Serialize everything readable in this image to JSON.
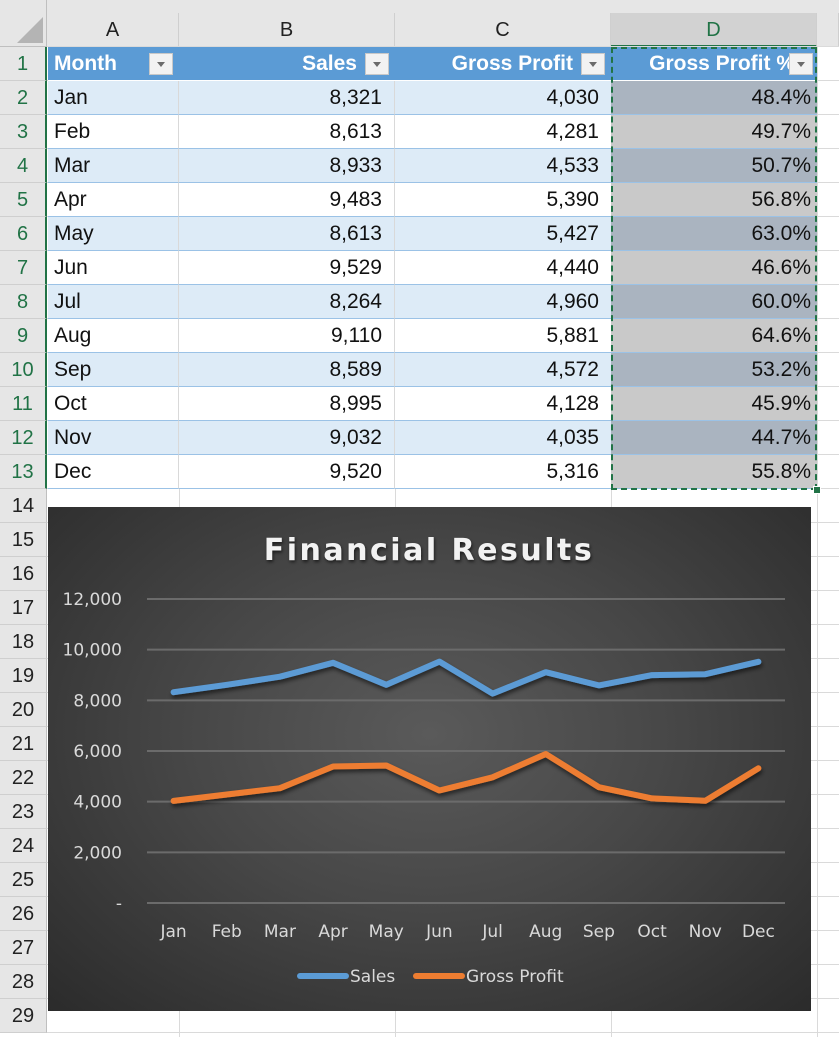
{
  "spreadsheet": {
    "columns": [
      "A",
      "B",
      "C",
      "D"
    ],
    "selected_column": "D",
    "row_numbers": [
      "1",
      "2",
      "3",
      "4",
      "5",
      "6",
      "7",
      "8",
      "9",
      "10",
      "11",
      "12",
      "13",
      "14",
      "15",
      "16",
      "17",
      "18",
      "19",
      "20",
      "21",
      "22",
      "23",
      "24",
      "25",
      "26",
      "27",
      "28",
      "29"
    ],
    "table": {
      "headers": [
        "Month",
        "Sales",
        "Gross Profit",
        "Gross Profit %"
      ],
      "rows": [
        [
          "Jan",
          "8,321",
          "4,030",
          "48.4%"
        ],
        [
          "Feb",
          "8,613",
          "4,281",
          "49.7%"
        ],
        [
          "Mar",
          "8,933",
          "4,533",
          "50.7%"
        ],
        [
          "Apr",
          "9,483",
          "5,390",
          "56.8%"
        ],
        [
          "May",
          "8,613",
          "5,427",
          "63.0%"
        ],
        [
          "Jun",
          "9,529",
          "4,440",
          "46.6%"
        ],
        [
          "Jul",
          "8,264",
          "4,960",
          "60.0%"
        ],
        [
          "Aug",
          "9,110",
          "5,881",
          "64.6%"
        ],
        [
          "Sep",
          "8,589",
          "4,572",
          "53.2%"
        ],
        [
          "Oct",
          "8,995",
          "4,128",
          "45.9%"
        ],
        [
          "Nov",
          "9,032",
          "4,035",
          "44.7%"
        ],
        [
          "Dec",
          "9,520",
          "5,316",
          "55.8%"
        ]
      ]
    },
    "colors": {
      "header_fill": "#5b9bd5",
      "band_fill": "#ddebf7",
      "selection": "#217346"
    }
  },
  "chart_data": {
    "type": "line",
    "title": "Financial Results",
    "categories": [
      "Jan",
      "Feb",
      "Mar",
      "Apr",
      "May",
      "Jun",
      "Jul",
      "Aug",
      "Sep",
      "Oct",
      "Nov",
      "Dec"
    ],
    "series": [
      {
        "name": "Sales",
        "color": "#5b9bd5",
        "values": [
          8321,
          8613,
          8933,
          9483,
          8613,
          9529,
          8264,
          9110,
          8589,
          8995,
          9032,
          9520
        ]
      },
      {
        "name": "Gross Profit",
        "color": "#ed7d31",
        "values": [
          4030,
          4281,
          4533,
          5390,
          5427,
          4440,
          4960,
          5881,
          4572,
          4128,
          4035,
          5316
        ]
      }
    ],
    "xlabel": "",
    "ylabel": "",
    "ylim": [
      0,
      12000
    ],
    "yticks": [
      0,
      2000,
      4000,
      6000,
      8000,
      10000,
      12000
    ],
    "ytick_labels": [
      "-",
      "2,000",
      "4,000",
      "6,000",
      "8,000",
      "10,000",
      "12,000"
    ],
    "grid": true,
    "legend": "bottom"
  }
}
